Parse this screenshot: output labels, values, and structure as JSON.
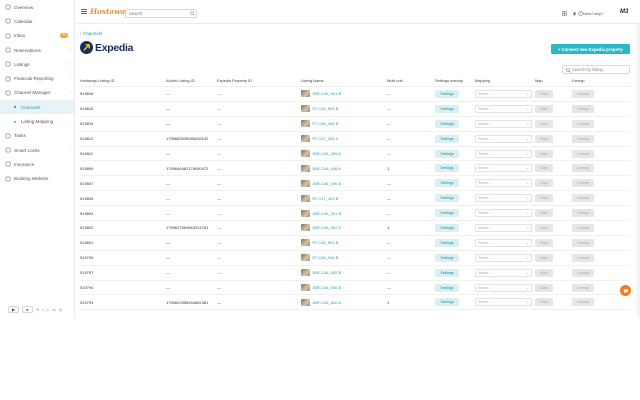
{
  "sidebar": {
    "items": [
      {
        "name": "overview",
        "label": "Overview",
        "icon": "grid-icon"
      },
      {
        "name": "calendar",
        "label": "Calendar",
        "icon": "calendar-icon"
      },
      {
        "name": "inbox",
        "label": "Inbox",
        "icon": "inbox-icon",
        "badge": "99"
      },
      {
        "name": "reservations",
        "label": "Reservations",
        "icon": "reservations-icon"
      },
      {
        "name": "listings",
        "label": "Listings",
        "icon": "listings-icon"
      },
      {
        "name": "financial-reporting",
        "label": "Financial Reporting",
        "icon": "chart-icon"
      },
      {
        "name": "channel-manager",
        "label": "Channel Manager",
        "icon": "channel-icon"
      }
    ],
    "sub_items": [
      {
        "name": "channels",
        "label": "Channels",
        "active": true
      },
      {
        "name": "listing-mapping",
        "label": "Listing Mapping",
        "active": false
      }
    ],
    "items_after": [
      {
        "name": "tasks",
        "label": "Tasks",
        "icon": "tasks-icon"
      },
      {
        "name": "smart-locks",
        "label": "Smart Locks",
        "icon": "lock-icon"
      },
      {
        "name": "insurance",
        "label": "Insurance",
        "icon": "shield-icon"
      },
      {
        "name": "booking-website",
        "label": "Booking Website",
        "icon": "globe-icon"
      }
    ]
  },
  "header": {
    "logo_text": "Hostaway",
    "search_placeholder": "Search",
    "need_help": "Need help?",
    "user_mark": "M3"
  },
  "main": {
    "back_label": "Channels",
    "brand_name": "Expedia",
    "connect_button": "Connect new Expedia property",
    "search_placeholder": "Search by listing"
  },
  "table": {
    "columns": [
      "Hostaway Listing ID",
      "Airbnb Listing ID",
      "Expedia Property ID",
      "Listing Name",
      "Multi unit",
      "Settings markup",
      "Mapping",
      "Map",
      "Unmap"
    ],
    "settings_label": "Settings",
    "select_placeholder": "Select...",
    "map_label": "Map",
    "unmap_label": "Unmap",
    "rows": [
      {
        "id": "519818",
        "airbnb": "—",
        "expedia": "—",
        "name": "1BR-C46_601 B",
        "multi": "—"
      },
      {
        "id": "519816",
        "airbnb": "—",
        "expedia": "—",
        "name": "ST-C46_504 B",
        "multi": "—"
      },
      {
        "id": "519815",
        "airbnb": "—",
        "expedia": "—",
        "name": "ST-C46_404 B",
        "multi": "—"
      },
      {
        "id": "519812",
        "airbnb": "1759660505085439142",
        "expedia": "—",
        "name": "ST-C47_304 A",
        "multi": "—"
      },
      {
        "id": "519811",
        "airbnb": "—",
        "expedia": "—",
        "name": "1BR-C46_405 A",
        "multi": "—"
      },
      {
        "id": "519809",
        "airbnb": "1759646482176090472",
        "expedia": "—",
        "name": "1BR-C46_406 A",
        "multi": "1"
      },
      {
        "id": "519807",
        "airbnb": "—",
        "expedia": "—",
        "name": "1BR-C46_406 B",
        "multi": "—"
      },
      {
        "id": "519805",
        "airbnb": "—",
        "expedia": "—",
        "name": "ST-C47_403 B",
        "multi": "—"
      },
      {
        "id": "519804",
        "airbnb": "—",
        "expedia": "—",
        "name": "1BR-C46_201 B",
        "multi": "—"
      },
      {
        "id": "519802",
        "airbnb": "1759627564963914781",
        "expedia": "—",
        "name": "1BR-C46_502 A",
        "multi": "1"
      },
      {
        "id": "519801",
        "airbnb": "—",
        "expedia": "—",
        "name": "ST-C46_503 B",
        "multi": "—"
      },
      {
        "id": "519799",
        "airbnb": "—",
        "expedia": "—",
        "name": "ST-C46_304 B",
        "multi": "—"
      },
      {
        "id": "519797",
        "airbnb": "—",
        "expedia": "—",
        "name": "1BR-C46_505 B",
        "multi": "—"
      },
      {
        "id": "519794",
        "airbnb": "—",
        "expedia": "—",
        "name": "1BR-C46_506 B",
        "multi": "—"
      },
      {
        "id": "519793",
        "airbnb": "1759620355944692381",
        "expedia": "—",
        "name": "1BR-C46_602 A",
        "multi": "1"
      }
    ]
  },
  "colors": {
    "accent": "#2bb7c4",
    "brand": "#1a2b5f",
    "fab": "#f47a1f"
  }
}
